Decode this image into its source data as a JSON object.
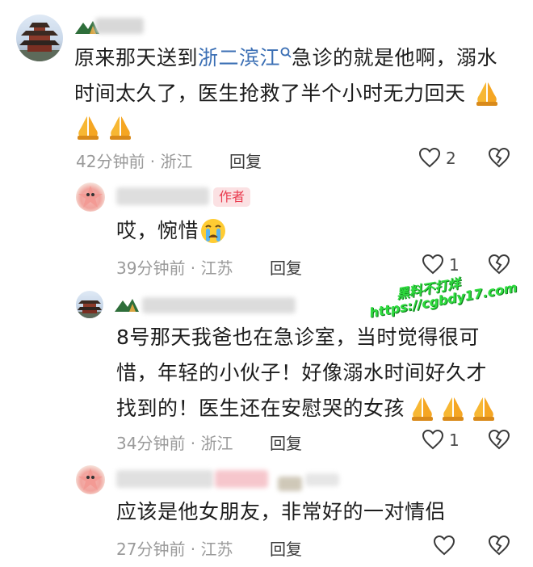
{
  "comments": [
    {
      "line1_prefix": "原来那天送到",
      "link": "浙二滨江",
      "line1_suffix": "急诊的就是他啊，溺水",
      "line2": "时间太久了，医生抢救了半个小时无力回天",
      "time": "42分钟前 · 浙江",
      "reply": "回复",
      "likes": "2"
    },
    {
      "badge": "作者",
      "line1": "哎，惋惜",
      "time": "39分钟前 · 江苏",
      "reply": "回复",
      "likes": "1"
    },
    {
      "line1": "8号那天我爸也在急诊室，当时觉得很可",
      "line2": "惜，年轻的小伙子！好像溺水时间好久才",
      "line3": "找到的！医生还在安慰哭的女孩",
      "time": "34分钟前 · 浙江",
      "reply": "回复",
      "likes": "1"
    },
    {
      "line1": "应该是他女朋友，非常好的一对情侣",
      "time": "27分钟前 · 江苏",
      "reply": "回复"
    }
  ],
  "watermark": {
    "line1": "黑料不打烊",
    "line2": "https://cgbdy17.com"
  },
  "icons": {
    "like": "heart-outline-icon",
    "dislike": "broken-heart-icon",
    "pray": "praying-hands-emoji",
    "cry": "crying-face-emoji"
  }
}
